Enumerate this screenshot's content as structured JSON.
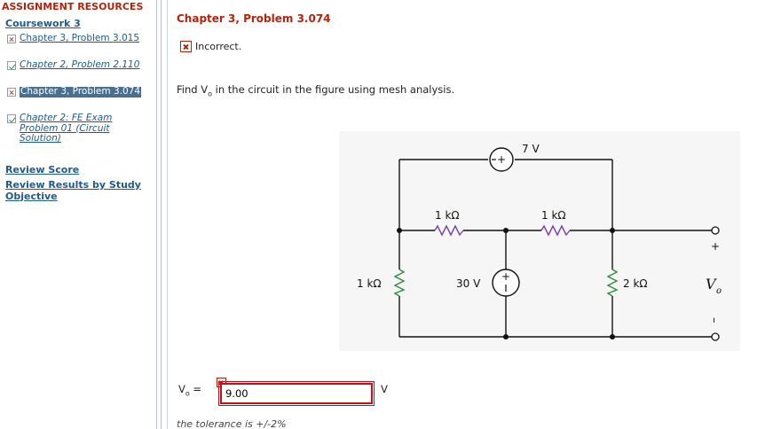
{
  "sidebar": {
    "section_title": "ASSIGNMENT RESOURCES",
    "coursework": "Coursework 3",
    "items": [
      {
        "label": "Chapter 3, Problem 3.015",
        "status": "incorrect",
        "italic": false
      },
      {
        "label": "Chapter 2, Problem 2.110",
        "status": "correct",
        "italic": true
      },
      {
        "label": "Chapter 3, Problem 3.074",
        "status": "incorrect",
        "italic": false,
        "active": true
      },
      {
        "label": "Chapter 2: FE Exam Problem 01 (Circuit Solution)",
        "status": "correct",
        "italic": true
      }
    ],
    "review_score": "Review Score",
    "review_results": "Review Results by Study Objective"
  },
  "main": {
    "problem_title": "Chapter 3, Problem 3.074",
    "result_text": "Incorrect.",
    "question_prefix": "Find V",
    "question_sub": "o",
    "question_suffix": " in the circuit in the figure using mesh analysis.",
    "figure": {
      "top_source": "7 V",
      "r_top_left": "1 kΩ",
      "r_top_right": "1 kΩ",
      "r_left": "1 kΩ",
      "source_mid": "30 V",
      "r_right": "2 kΩ",
      "plus": "+",
      "minus": "–",
      "vo": "V",
      "vo_sub": "o"
    },
    "answer": {
      "label": "V",
      "label_sub": "o",
      "equals": " =",
      "value": "9.00",
      "unit": "V"
    },
    "tolerance": "the tolerance is +/-2%"
  },
  "colors": {
    "brand_red": "#b3240b",
    "link_blue": "#1f5a8a",
    "active_bg": "#4a6e8e",
    "error_border": "#c0101a"
  }
}
